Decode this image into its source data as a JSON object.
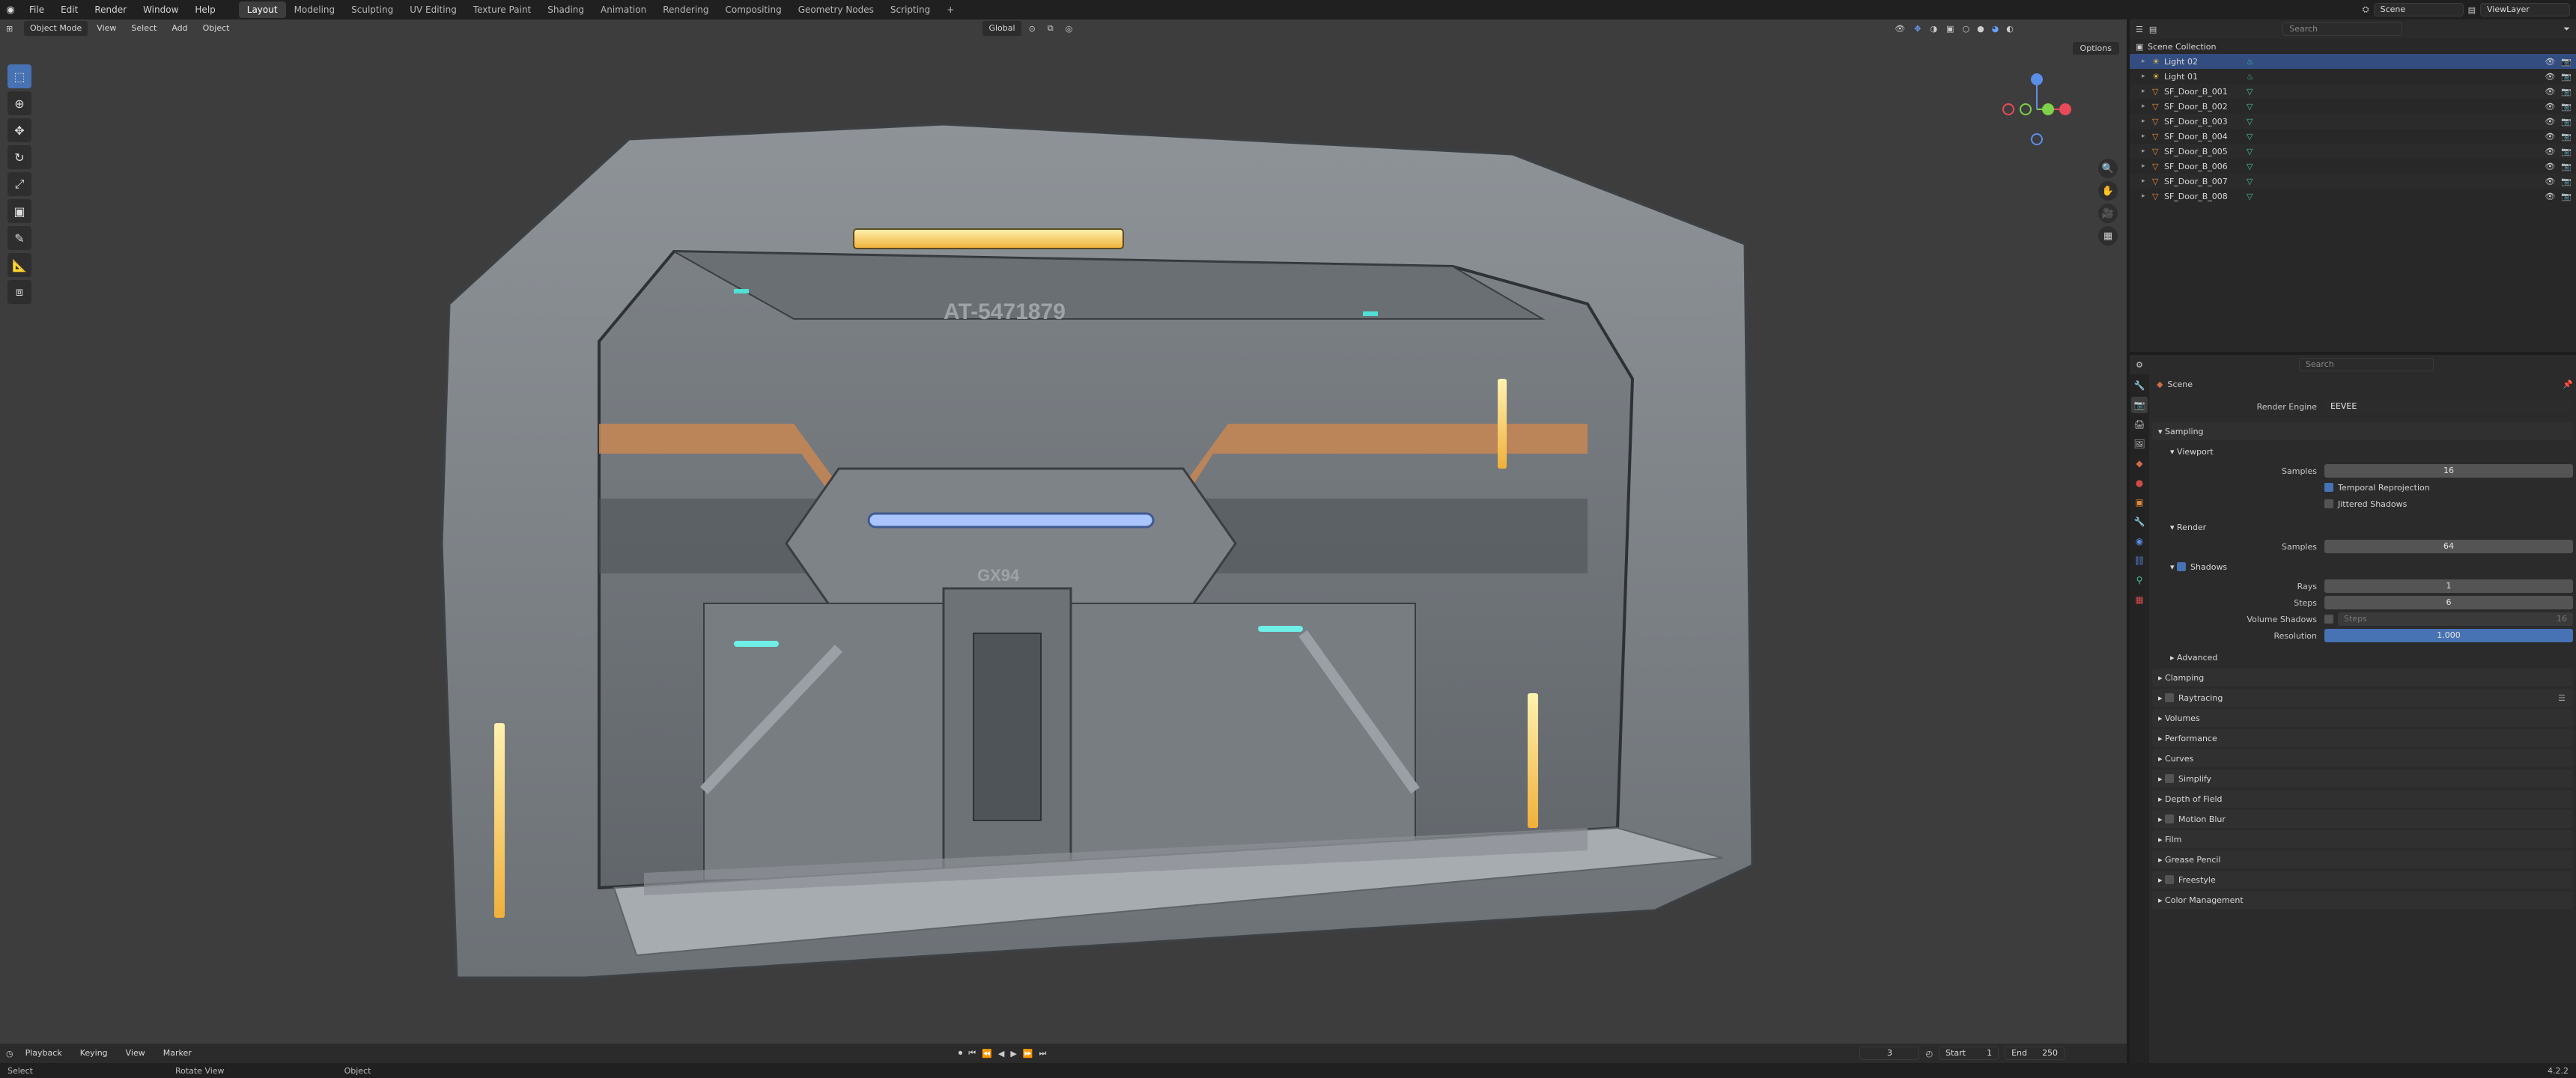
{
  "topbar": {
    "menus": [
      "File",
      "Edit",
      "Render",
      "Window",
      "Help"
    ],
    "workspaces": [
      "Layout",
      "Modeling",
      "Sculpting",
      "UV Editing",
      "Texture Paint",
      "Shading",
      "Animation",
      "Rendering",
      "Compositing",
      "Geometry Nodes",
      "Scripting"
    ],
    "active_workspace": "Layout",
    "add_tab": "+",
    "scene": "Scene",
    "view_layer": "ViewLayer"
  },
  "viewport": {
    "mode": "Object Mode",
    "menus": [
      "View",
      "Select",
      "Add",
      "Object"
    ],
    "orientation": "Global",
    "options": "Options",
    "labels": {
      "door_code": "AT-5471879",
      "panel_code": "GX94"
    }
  },
  "outliner": {
    "search_placeholder": "Search",
    "collection": "Scene Collection",
    "items": [
      {
        "name": "Light 02",
        "type": "light",
        "selected": true
      },
      {
        "name": "Light 01",
        "type": "light",
        "selected": false
      },
      {
        "name": "SF_Door_B_001",
        "type": "mesh",
        "selected": false
      },
      {
        "name": "SF_Door_B_002",
        "type": "mesh",
        "selected": false
      },
      {
        "name": "SF_Door_B_003",
        "type": "mesh",
        "selected": false
      },
      {
        "name": "SF_Door_B_004",
        "type": "mesh",
        "selected": false
      },
      {
        "name": "SF_Door_B_005",
        "type": "mesh",
        "selected": false
      },
      {
        "name": "SF_Door_B_006",
        "type": "mesh",
        "selected": false
      },
      {
        "name": "SF_Door_B_007",
        "type": "mesh",
        "selected": false
      },
      {
        "name": "SF_Door_B_008",
        "type": "mesh",
        "selected": false
      }
    ]
  },
  "properties": {
    "search_placeholder": "Search",
    "context": "Scene",
    "render_engine_label": "Render Engine",
    "render_engine": "EEVEE",
    "sampling": "Sampling",
    "viewport": "Viewport",
    "samples_label": "Samples",
    "viewport_samples": "16",
    "temporal_reprojection": "Temporal Reprojection",
    "jittered_shadows": "Jittered Shadows",
    "render": "Render",
    "render_samples": "64",
    "shadows": "Shadows",
    "rays_label": "Rays",
    "rays": "1",
    "steps_label": "Steps",
    "steps": "6",
    "volume_shadows_label": "Volume Shadows",
    "volume_steps_label": "Steps",
    "volume_steps": "16",
    "resolution_label": "Resolution",
    "resolution": "1.000",
    "advanced": "Advanced",
    "sections": [
      "Clamping",
      "Raytracing",
      "Volumes",
      "Performance",
      "Curves",
      "Simplify",
      "Depth of Field",
      "Motion Blur",
      "Film",
      "Grease Pencil",
      "Freestyle",
      "Color Management"
    ]
  },
  "timeline": {
    "menus": [
      "Playback",
      "Keying",
      "View",
      "Marker"
    ],
    "current_frame": "3",
    "start_label": "Start",
    "start": "1",
    "end_label": "End",
    "end": "250"
  },
  "statusbar": {
    "items": [
      "Select",
      "Rotate View",
      "Object"
    ],
    "version": "4.2.2"
  }
}
